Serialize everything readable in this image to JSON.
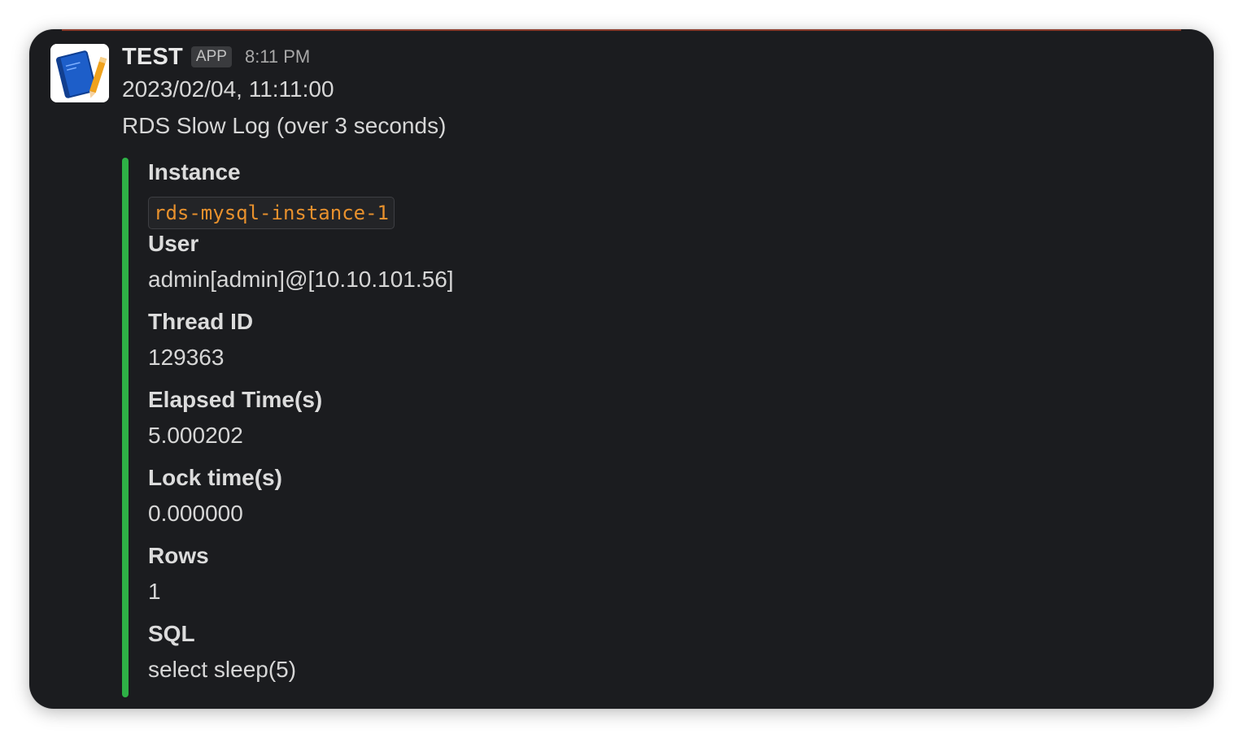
{
  "message": {
    "sender": "TEST",
    "badge": "APP",
    "time": "8:11 PM",
    "lines": [
      "2023/02/04, 11:11:00",
      "RDS Slow Log (over 3 seconds)"
    ]
  },
  "attachment": {
    "color": "#2eb146",
    "fields": [
      {
        "title": "Instance",
        "value": "rds-mysql-instance-1"
      },
      {
        "title": "User",
        "value": "admin[admin]@[10.10.101.56]"
      },
      {
        "title": "Thread ID",
        "value": "129363"
      },
      {
        "title": "Elapsed Time(s)",
        "value": "5.000202"
      },
      {
        "title": "Lock time(s)",
        "value": "0.000000"
      },
      {
        "title": "Rows",
        "value": "1"
      },
      {
        "title": "SQL",
        "value": "select sleep(5)"
      }
    ]
  },
  "icons": {
    "avatar": "notebook-app-icon"
  },
  "colors": {
    "background": "#1b1c1f",
    "code_text": "#e8912d"
  }
}
